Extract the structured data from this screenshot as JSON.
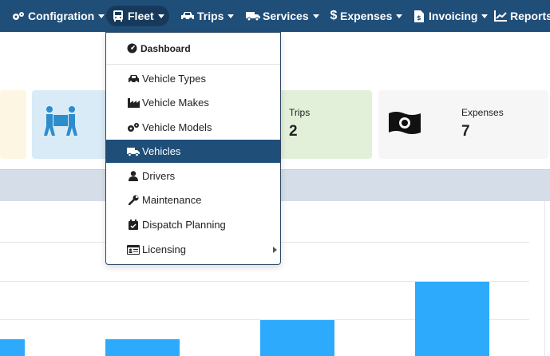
{
  "navbar": {
    "items": [
      {
        "label": "Configration",
        "icon": "cogs-icon"
      },
      {
        "label": "Fleet",
        "icon": "bus-icon",
        "active": true
      },
      {
        "label": "Trips",
        "icon": "car-icon"
      },
      {
        "label": "Services",
        "icon": "truck-icon"
      },
      {
        "label": "Expenses",
        "icon": "dollar-icon"
      },
      {
        "label": "Invoicing",
        "icon": "invoice-icon"
      },
      {
        "label": "Reports",
        "icon": "chart-line-icon"
      }
    ]
  },
  "cards": {
    "trips": {
      "label": "Trips",
      "value": "2"
    },
    "expenses": {
      "label": "Expenses",
      "value": "7"
    }
  },
  "fleet_menu": {
    "header": "Dashboard",
    "items": [
      {
        "label": "Vehicle Types",
        "icon": "car-icon"
      },
      {
        "label": "Vehicle Makes",
        "icon": "industry-icon"
      },
      {
        "label": "Vehicle Models",
        "icon": "cogs-icon"
      },
      {
        "label": "Vehicles",
        "icon": "truck-icon",
        "active": true
      },
      {
        "label": "Drivers",
        "icon": "user-icon"
      },
      {
        "label": "Maintenance",
        "icon": "wrench-icon"
      },
      {
        "label": "Dispatch Planning",
        "icon": "calendar-check-icon"
      },
      {
        "label": "Licensing",
        "icon": "id-card-icon",
        "submenu": true
      }
    ]
  },
  "colors": {
    "navbar": "#1f4e79",
    "active_item": "#1f4e79",
    "bar": "#2daafc"
  }
}
